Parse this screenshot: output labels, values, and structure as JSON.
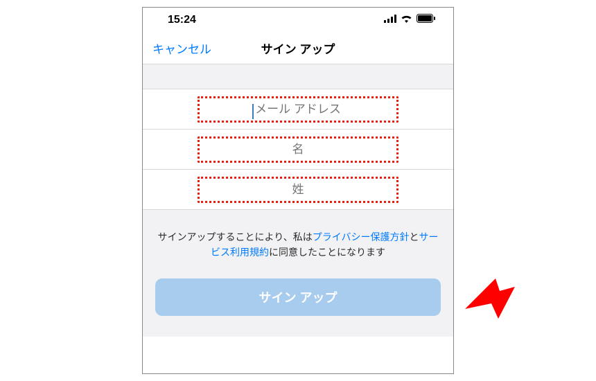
{
  "status": {
    "time": "15:24"
  },
  "nav": {
    "cancel": "キャンセル",
    "title": "サイン アップ"
  },
  "form": {
    "email_placeholder": "メール アドレス",
    "firstname_placeholder": "名",
    "lastname_placeholder": "姓"
  },
  "agreement": {
    "part1": "サインアップすることにより、私は",
    "privacy_link": "プライバシー保護方針",
    "and": "と",
    "tos_link": "サービス利用規約",
    "part2": "に同意したことになります"
  },
  "button": {
    "signup": "サイン アップ"
  }
}
